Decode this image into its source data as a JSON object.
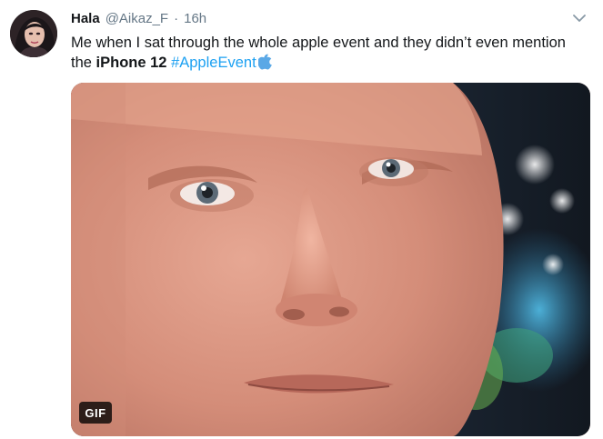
{
  "tweet": {
    "author": {
      "name": "Hala",
      "handle": "@Aikaz_F",
      "separator": "·",
      "time": "16h"
    },
    "text": {
      "before": "Me when I sat through the whole apple event and they didn’t even mention the ",
      "bold": "iPhone 12",
      "space": " ",
      "hashtag": "#AppleEvent"
    },
    "media": {
      "type_badge": "GIF",
      "description_icon": "face-gif"
    },
    "icons": {
      "menu": "chevron-down-icon",
      "emoji": "apple-icon",
      "avatar": "avatar"
    },
    "colors": {
      "hashtag": "#1da1f2",
      "meta": "#657786",
      "text": "#14171a",
      "emoji_blue": "#5aa8e6"
    }
  }
}
